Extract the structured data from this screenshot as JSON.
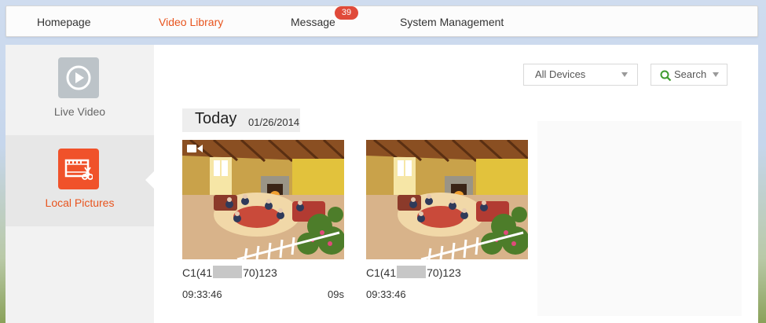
{
  "nav": {
    "items": [
      {
        "label": "Homepage",
        "active": false
      },
      {
        "label": "Video Library",
        "active": true
      },
      {
        "label": "Message",
        "active": false
      },
      {
        "label": "System Management",
        "active": false
      }
    ],
    "message_badge": "39"
  },
  "sidebar": {
    "items": [
      {
        "label": "Live Video",
        "icon": "play-circle-icon",
        "active": false
      },
      {
        "label": "Local Pictures",
        "icon": "film-scissors-icon",
        "active": true
      }
    ]
  },
  "filters": {
    "device_select": "All Devices",
    "search_label": "Search"
  },
  "day": {
    "title": "Today",
    "date": "01/26/2014"
  },
  "cards": [
    {
      "camera_prefix": "C1(41",
      "camera_suffix": "70)123",
      "time": "09:33:46",
      "duration": "09s",
      "type_icon": "video-camera-icon"
    },
    {
      "camera_prefix": "C1(41",
      "camera_suffix": "70)123",
      "time": "09:33:46",
      "duration": "",
      "type_icon": ""
    }
  ],
  "colors": {
    "accent": "#e8541e",
    "badge": "#e04a3a",
    "live_icon_bg": "#bcc3c8",
    "local_icon_bg": "#f0522a",
    "search_icon": "#3f9b2f"
  }
}
